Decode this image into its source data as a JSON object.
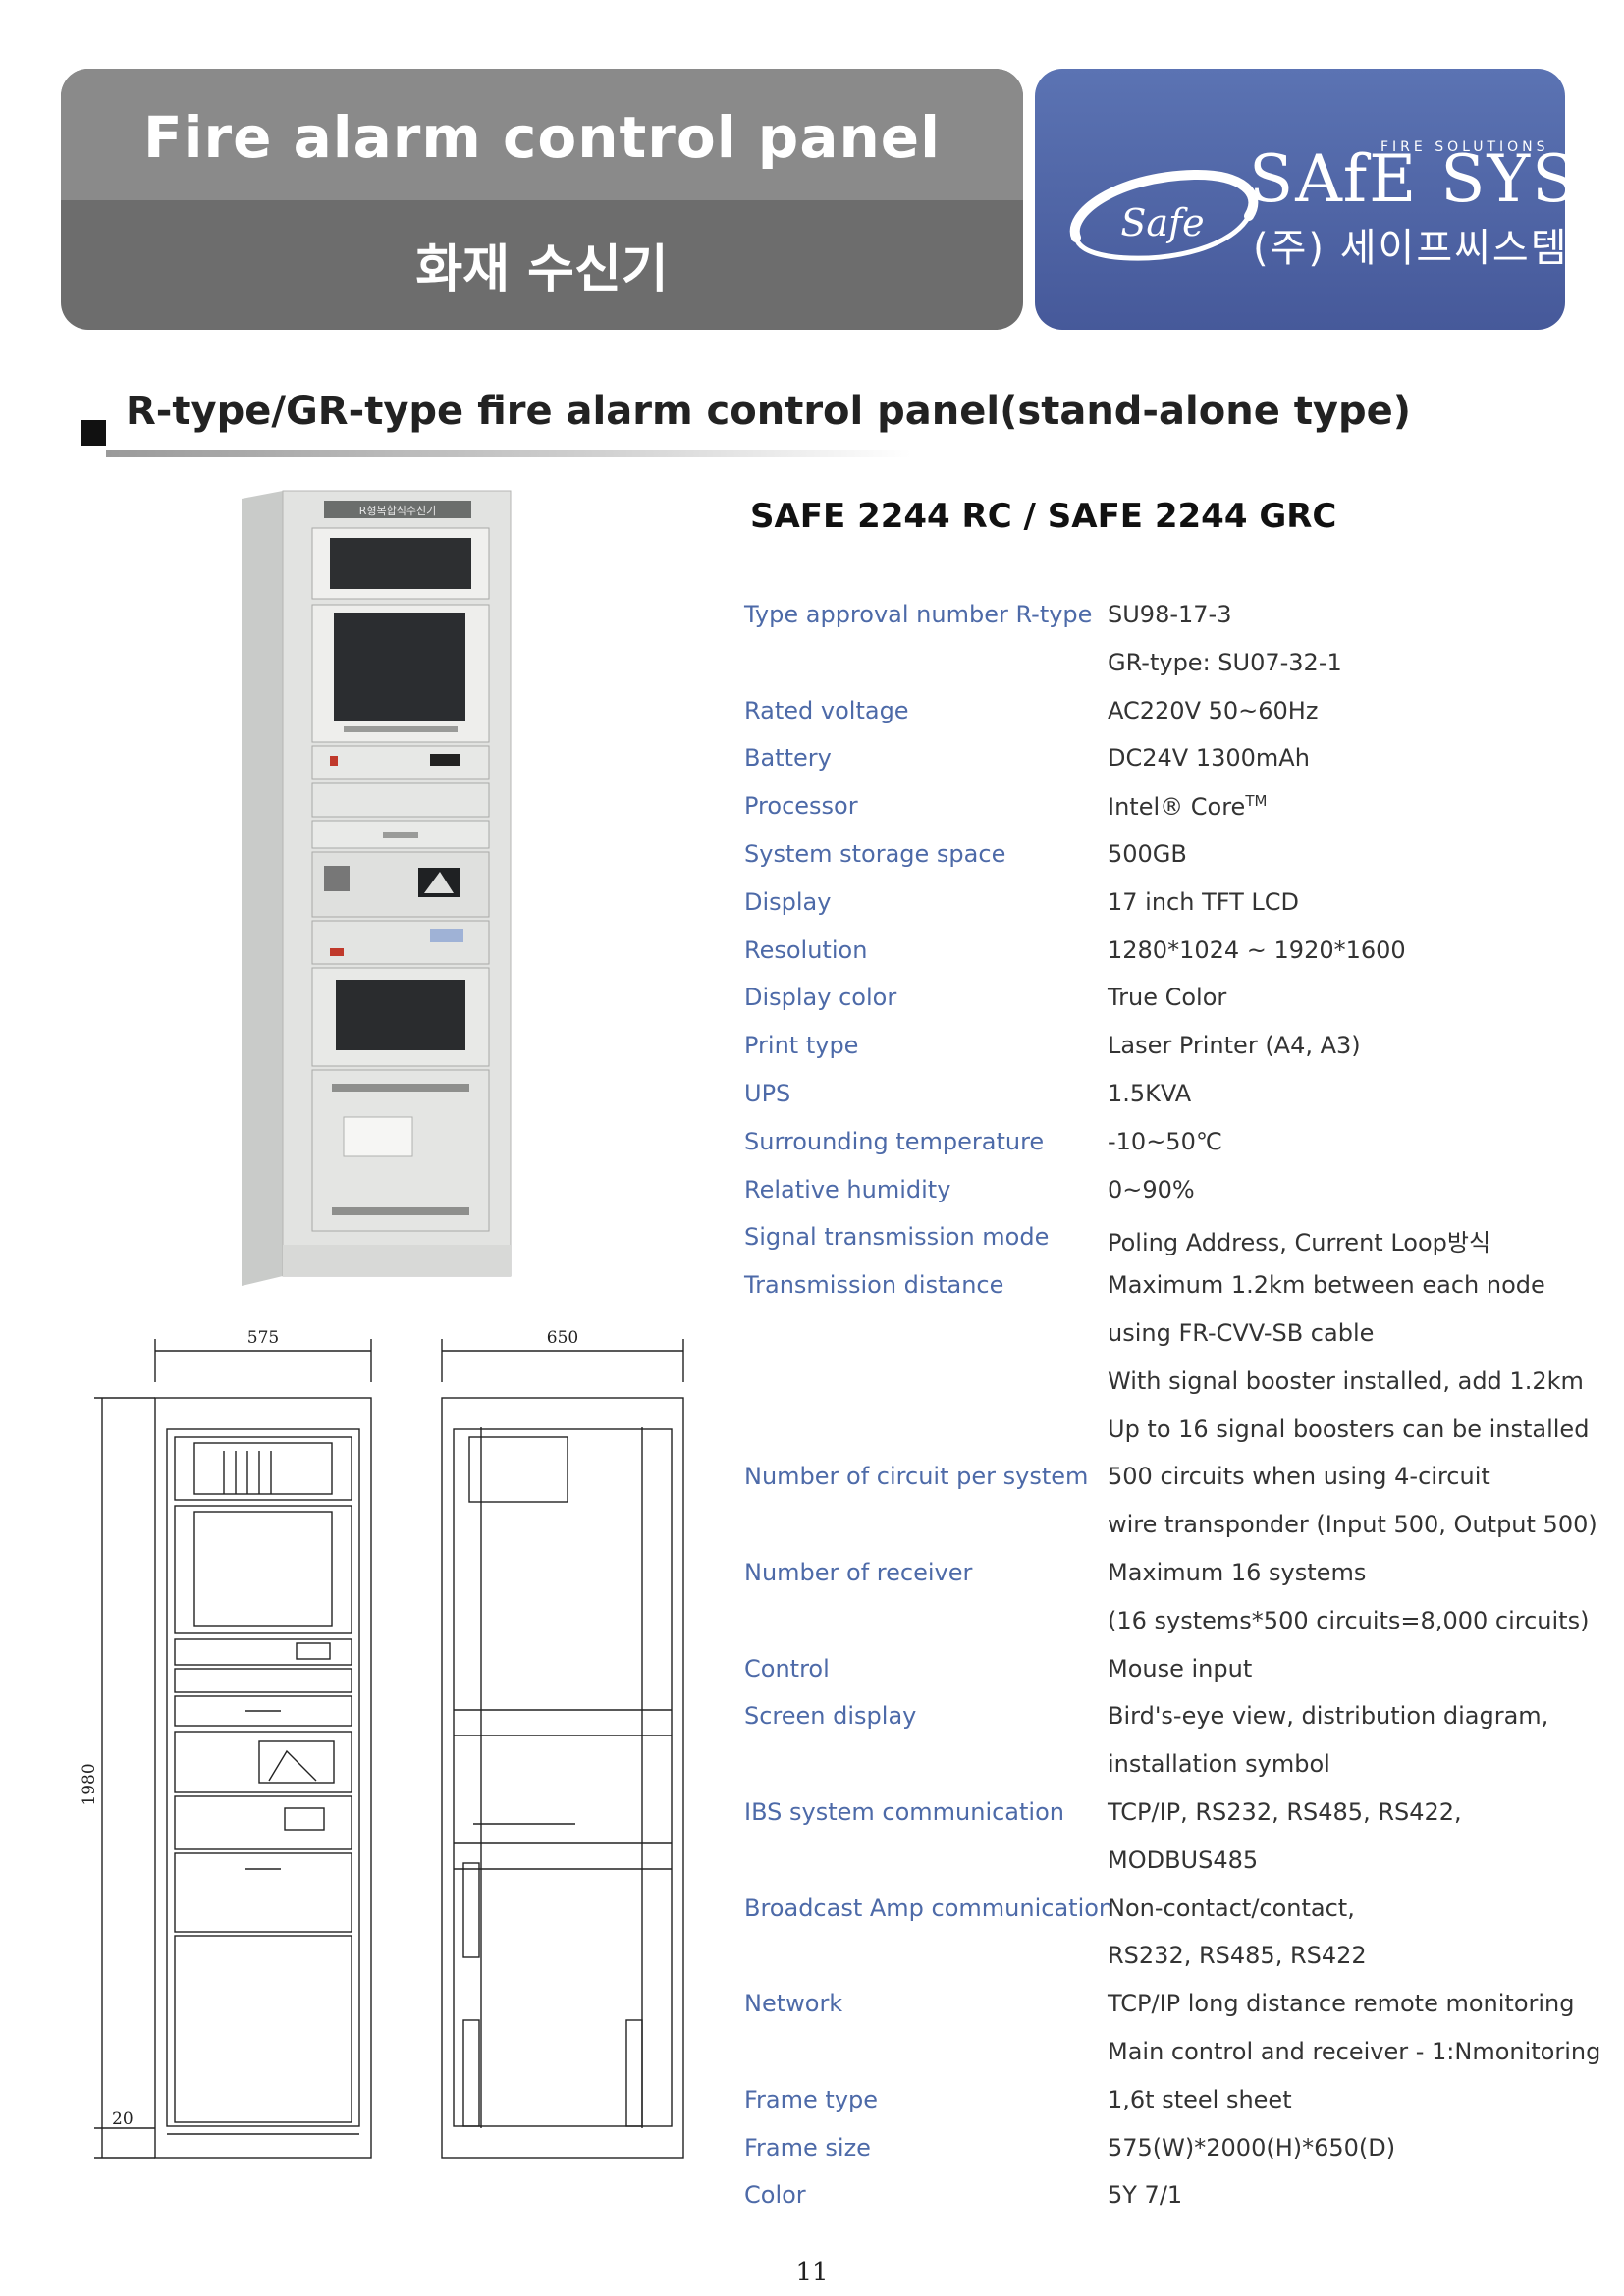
{
  "header": {
    "title_en": "Fire alarm control panel",
    "title_ko": "화재 수신기"
  },
  "logo": {
    "emblem_text": "Safe",
    "tagline": "FIRE SOLUTIONS",
    "brand": "SAfE SYSTEM",
    "company_ko": "(주) 세이프씨스템"
  },
  "section": {
    "title": "R-type/GR-type fire alarm control panel(stand-alone type)"
  },
  "product": {
    "model": "SAFE 2244 RC / SAFE 2244 GRC",
    "photo_label": "R형복합식수신기"
  },
  "specs": [
    {
      "label": "Type approval number R-type",
      "value": "SU98-17-3"
    },
    {
      "label": "",
      "value": "GR-type: SU07-32-1"
    },
    {
      "label": "Rated voltage",
      "value": "AC220V 50~60Hz"
    },
    {
      "label": "Battery",
      "value": "DC24V 1300mAh"
    },
    {
      "label": "Processor",
      "value": "Intel® Core",
      "sup": "TM"
    },
    {
      "label": "System storage space",
      "value": "500GB"
    },
    {
      "label": "Display",
      "value": "17 inch TFT LCD"
    },
    {
      "label": "Resolution",
      "value": "1280*1024 ~ 1920*1600"
    },
    {
      "label": "Display color",
      "value": "True Color"
    },
    {
      "label": "Print type",
      "value": "Laser Printer (A4, A3)"
    },
    {
      "label": "UPS",
      "value": "1.5KVA"
    },
    {
      "label": "Surrounding temperature",
      "value": "-10~50℃"
    },
    {
      "label": "Relative humidity",
      "value": "0~90%"
    },
    {
      "label": "Signal transmission mode",
      "value": "Poling Address, Current Loop방식"
    },
    {
      "label": "Transmission distance",
      "value": "Maximum 1.2km between each node"
    },
    {
      "label": "",
      "value": "using FR-CVV-SB cable"
    },
    {
      "label": "",
      "value": "With signal booster installed, add 1.2km"
    },
    {
      "label": "",
      "value": "Up to 16 signal boosters can be installed"
    },
    {
      "label": "Number of circuit per system",
      "value": "500 circuits when using 4-circuit"
    },
    {
      "label": "",
      "value": "wire transponder (Input 500, Output 500)"
    },
    {
      "label": "Number of receiver",
      "value": "Maximum 16 systems"
    },
    {
      "label": "",
      "value": "(16 systems*500 circuits=8,000 circuits)"
    },
    {
      "label": "Control",
      "value": "Mouse input"
    },
    {
      "label": "Screen display",
      "value": "Bird's-eye view, distribution diagram,"
    },
    {
      "label": "",
      "value": "installation symbol"
    },
    {
      "label": "IBS system communication",
      "value": "TCP/IP, RS232, RS485, RS422,"
    },
    {
      "label": "",
      "value": "MODBUS485"
    },
    {
      "label": "Broadcast Amp communication",
      "value": "Non-contact/contact,"
    },
    {
      "label": "",
      "value": "RS232, RS485, RS422"
    },
    {
      "label": "Network",
      "value": "TCP/IP long distance remote monitoring"
    },
    {
      "label": "",
      "value": "Main control and receiver - 1:Nmonitoring"
    },
    {
      "label": "Frame type",
      "value": "1,6t steel sheet"
    },
    {
      "label": "Frame size",
      "value": "575(W)*2000(H)*650(D)"
    },
    {
      "label": "Color",
      "value": "5Y 7/1"
    }
  ],
  "drawing": {
    "width_dim": "575",
    "depth_dim": "650",
    "height_dim": "1980",
    "base_dim": "20"
  },
  "page_number": "11"
}
